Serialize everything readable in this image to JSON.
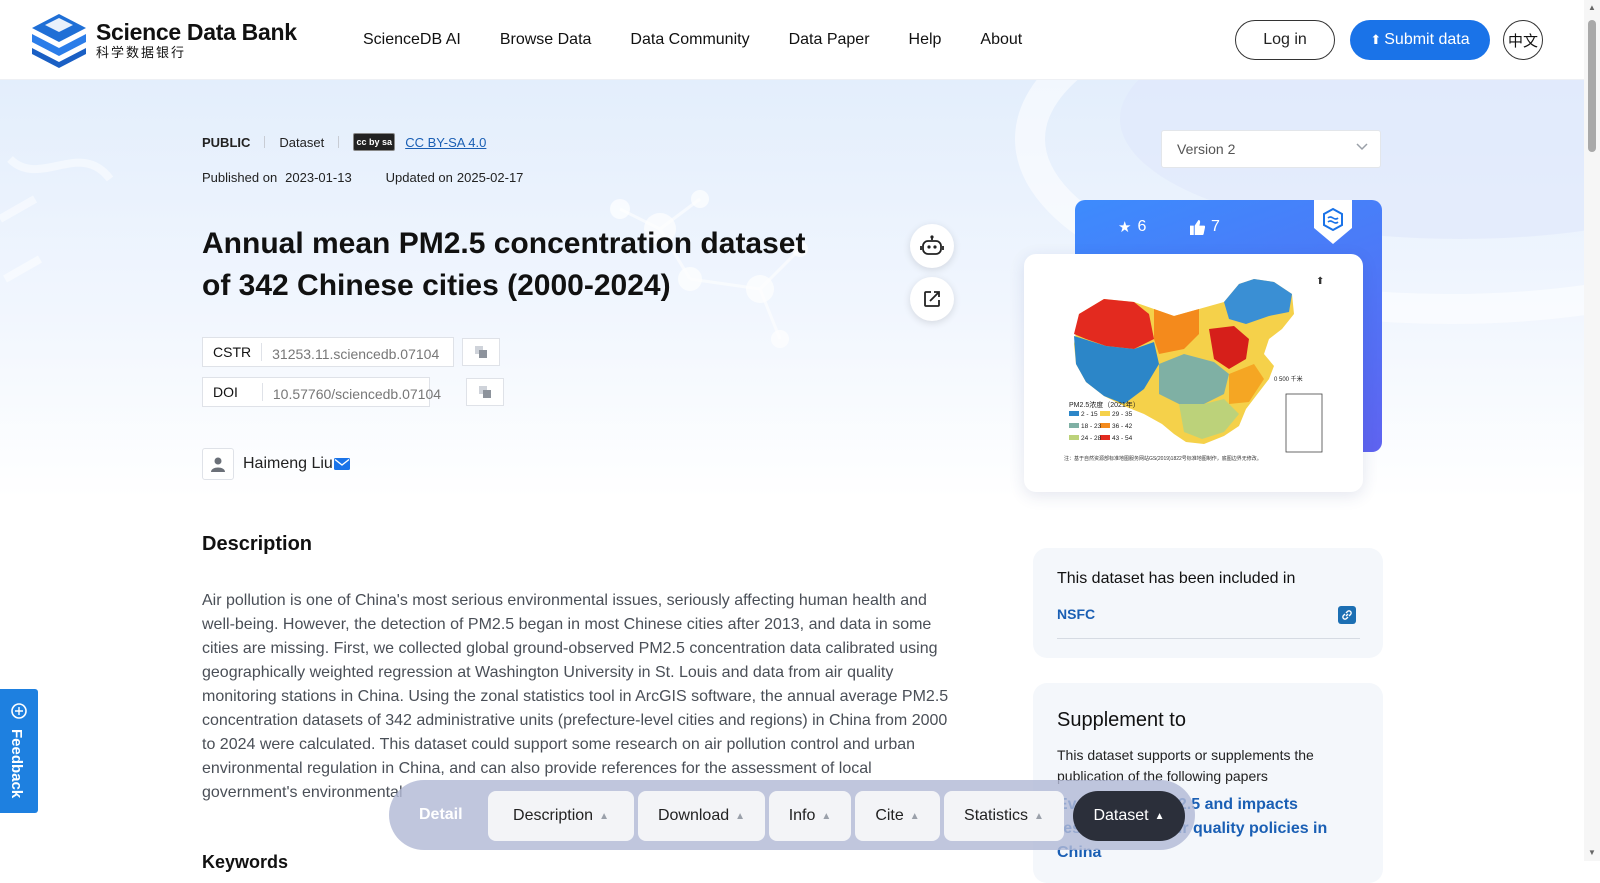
{
  "brand": {
    "name_en": "Science Data Bank",
    "name_cn": "科学数据银行",
    "colors": {
      "primary": "#1a73e8",
      "link": "#1a5fb4",
      "logo": "#1f6fd6"
    }
  },
  "nav": {
    "items": [
      "ScienceDB AI",
      "Browse Data",
      "Data Community",
      "Data Paper",
      "Help",
      "About"
    ],
    "login": "Log in",
    "submit": "Submit data",
    "lang": "中文"
  },
  "dataset": {
    "visibility": "PUBLIC",
    "type": "Dataset",
    "license": "CC BY-SA 4.0",
    "license_badge": "cc by sa",
    "published_label": "Published on",
    "published": "2023-01-13",
    "updated_label": "Updated on",
    "updated": "2025-02-17",
    "title": "Annual mean PM2.5 concentration dataset of 342 Chinese cities (2000-2024)",
    "cstr_label": "CSTR",
    "cstr": "31253.11.sciencedb.07104",
    "doi_label": "DOI",
    "doi": "10.57760/sciencedb.07104",
    "author": "Haimeng Liu"
  },
  "description": {
    "heading": "Description",
    "text": "Air pollution is one of China's most serious environmental issues, seriously affecting human health and well-being. However, the detection of PM2.5 began in most Chinese cities after 2013, and data in some cities are missing. First, we collected global ground-observed PM2.5 concentration data calibrated using geographically weighted regression at Washington University in St. Louis and data from air quality monitoring stations in China. Using the zonal statistics tool in ArcGIS software, the annual average PM2.5 concentration datasets of 342 administrative units (prefecture-level cities and regions) in China from 2000 to 2024 were calculated. This dataset could support some research on air pollution control and urban environmental regulation in China, and can also provide references for the assessment of local government's environmental",
    "keywords_heading": "Keywords"
  },
  "sidebar": {
    "version": "Version 2",
    "stars": "6",
    "likes": "7",
    "map_legend_title": "PM2.5浓度（2021年）",
    "map_legend": [
      "2 - 15",
      "29 - 35",
      "18 - 23",
      "36 - 42",
      "24 - 28",
      "43 - 54"
    ],
    "map_scale": "0   500 千米",
    "map_note": "注：基于自然资源部标准地图服务网站GS(2019)1822号标准地图制作，底图边界无修改。",
    "included_title": "This dataset has been included in",
    "included_name": "NSFC",
    "supplement_title": "Supplement to",
    "supplement_sub": "This dataset supports or supplements the publication of the following papers",
    "supplement_paper": "Evolution of PM2.5 and impacts resulting from air quality policies in China"
  },
  "tabbar": {
    "detail": "Detail",
    "tabs": [
      "Description",
      "Download",
      "Info",
      "Cite",
      "Statistics",
      "Dataset"
    ],
    "active": "Dataset"
  },
  "feedback": "Feedback"
}
